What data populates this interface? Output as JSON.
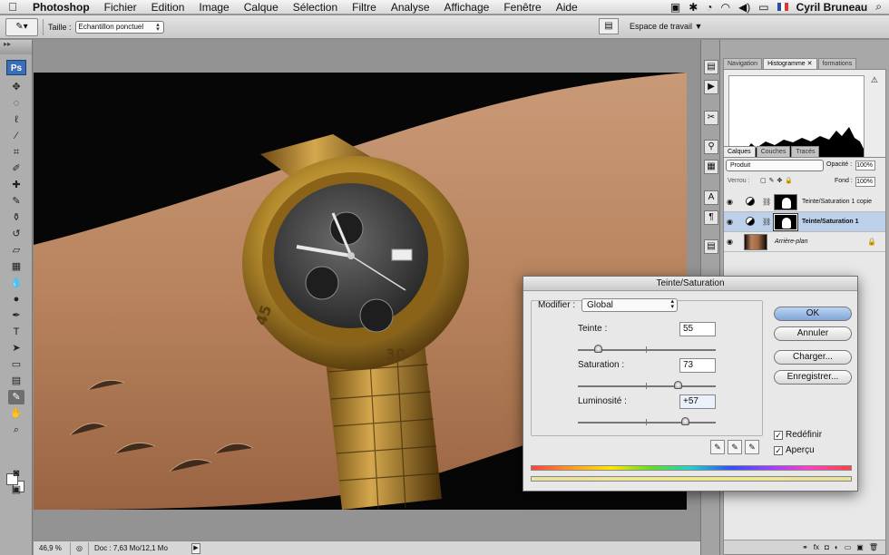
{
  "menubar": {
    "app": "Photoshop",
    "items": [
      "Fichier",
      "Edition",
      "Image",
      "Calque",
      "Sélection",
      "Filtre",
      "Analyse",
      "Affichage",
      "Fenêtre",
      "Aide"
    ],
    "user": "Cyril Bruneau"
  },
  "options": {
    "size_label": "Taille :",
    "size_value": "Echantillon ponctuel",
    "workspace": "Espace de travail ▼"
  },
  "statusbar": {
    "zoom": "46,9 %",
    "doc": "Doc : 7,63 Mo/12,1 Mo"
  },
  "panels": {
    "top_tabs": [
      "Navigation",
      "Histogramme",
      "formations"
    ],
    "layer_tabs": [
      "Calques",
      "Couches",
      "Tracés"
    ],
    "blend_mode": "Produit",
    "opacity_label": "Opacité :",
    "opacity": "100%",
    "lock_label": "Verrou :",
    "fill_label": "Fond :",
    "fill": "100%",
    "layers": [
      {
        "name": "Teinte/Saturation 1 copie",
        "selected": false
      },
      {
        "name": "Teinte/Saturation 1",
        "selected": true
      },
      {
        "name": "Arrière-plan",
        "selected": false
      }
    ]
  },
  "dialog": {
    "title": "Teinte/Saturation",
    "modifier_label": "Modifier :",
    "modifier_value": "Global",
    "hue_label": "Teinte :",
    "hue": "55",
    "sat_label": "Saturation :",
    "sat": "73",
    "light_label": "Luminosité :",
    "light": "+57",
    "buttons": {
      "ok": "OK",
      "cancel": "Annuler",
      "load": "Charger...",
      "save": "Enregistrer..."
    },
    "colorize_label": "Redéfinir",
    "colorize": true,
    "preview_label": "Aperçu",
    "preview": true
  },
  "colors": {
    "accent": "#3b6eb8",
    "selection": "#bcd0ea"
  }
}
